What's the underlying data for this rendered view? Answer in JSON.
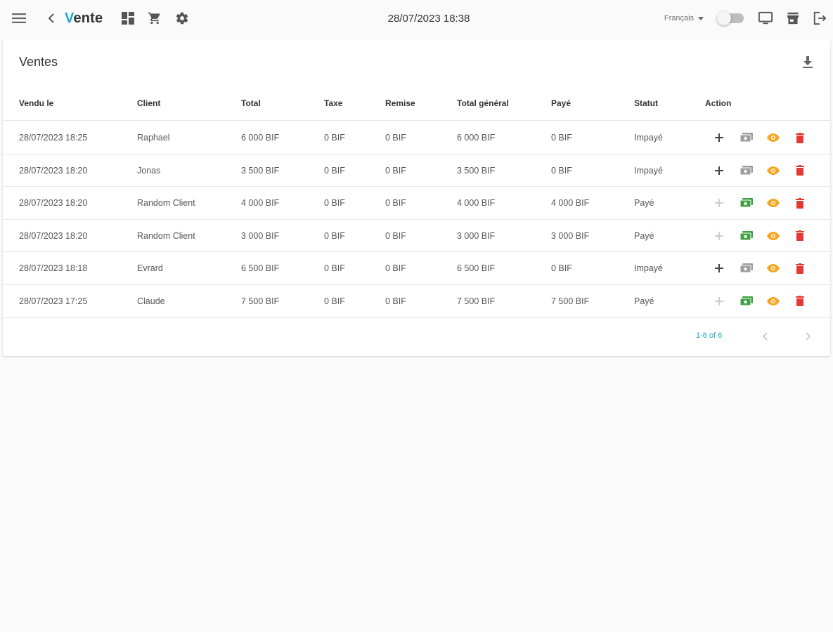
{
  "header": {
    "brand_first": "V",
    "brand_rest": "ente",
    "datetime": "28/07/2023 18:38",
    "language": "Français",
    "icons": [
      "menu-icon",
      "back-chevron-icon",
      "dashboard-icon",
      "cart-icon",
      "settings-icon",
      "monitor-icon",
      "store-icon",
      "logout-icon"
    ]
  },
  "sales": {
    "title": "Ventes",
    "columns": [
      "Vendu le",
      "Client",
      "Total",
      "Taxe",
      "Remise",
      "Total général",
      "Payé",
      "Statut",
      "Action"
    ],
    "rows": [
      {
        "date": "28/07/2023 18:25",
        "client": "Raphael",
        "total": "6 000 BIF",
        "tax": "0 BIF",
        "discount": "0 BIF",
        "grand_total": "6 000 BIF",
        "paid": "0 BIF",
        "status": "Impayé"
      },
      {
        "date": "28/07/2023 18:20",
        "client": "Jonas",
        "total": "3 500 BIF",
        "tax": "0 BIF",
        "discount": "0 BIF",
        "grand_total": "3 500 BIF",
        "paid": "0 BIF",
        "status": "Impayé"
      },
      {
        "date": "28/07/2023 18:20",
        "client": "Random Client",
        "total": "4 000 BIF",
        "tax": "0 BIF",
        "discount": "0 BIF",
        "grand_total": "4 000 BIF",
        "paid": "4 000 BIF",
        "status": "Payé"
      },
      {
        "date": "28/07/2023 18:20",
        "client": "Random Client",
        "total": "3 000 BIF",
        "tax": "0 BIF",
        "discount": "0 BIF",
        "grand_total": "3 000 BIF",
        "paid": "3 000 BIF",
        "status": "Payé"
      },
      {
        "date": "28/07/2023 18:18",
        "client": "Evrard",
        "total": "6 500 BIF",
        "tax": "0 BIF",
        "discount": "0 BIF",
        "grand_total": "6 500 BIF",
        "paid": "0 BIF",
        "status": "Impayé"
      },
      {
        "date": "28/07/2023 17:25",
        "client": "Claude",
        "total": "7 500 BIF",
        "tax": "0 BIF",
        "discount": "0 BIF",
        "grand_total": "7 500 BIF",
        "paid": "7 500 BIF",
        "status": "Payé"
      }
    ],
    "pagination": "1-6 of 6"
  },
  "colors": {
    "accent": "#1ba8c9",
    "paid_icon": "#43a047",
    "unpaid_icon": "#9e9e9e",
    "view_icon": "#f5a623",
    "delete_icon": "#e53935"
  }
}
